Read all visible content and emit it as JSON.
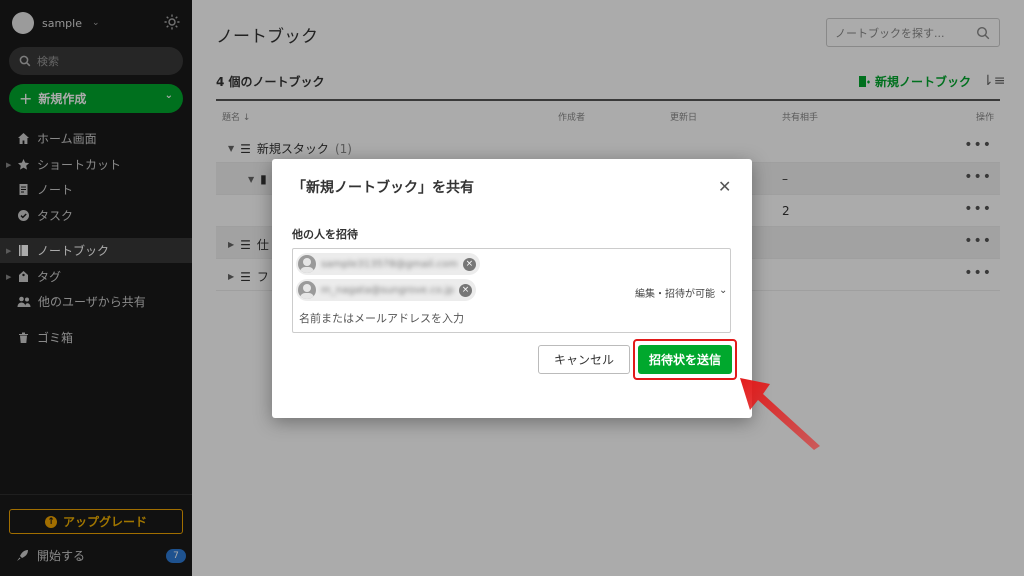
{
  "sidebar": {
    "account_name": "sample",
    "search_placeholder": "検索",
    "new_button": "新規作成",
    "nav": [
      {
        "label": "ホーム画面"
      },
      {
        "label": "ショートカット"
      },
      {
        "label": "ノート"
      },
      {
        "label": "タスク"
      },
      {
        "label": "ノートブック"
      },
      {
        "label": "タグ"
      },
      {
        "label": "他のユーザから共有"
      },
      {
        "label": "ゴミ箱"
      }
    ],
    "upgrade": "アップグレード",
    "get_started": "開始する",
    "get_started_badge": "7"
  },
  "main": {
    "title": "ノートブック",
    "search_placeholder": "ノートブックを探す...",
    "count": "4 個のノートブック",
    "new_notebook": "新規ノートブック",
    "columns": [
      "題名 ↓",
      "作成者",
      "更新日",
      "共有相手",
      "操作"
    ],
    "rows": [
      {
        "title": "新規スタック",
        "count": "(1)",
        "shared": "",
        "actions": "•••"
      },
      {
        "title": "",
        "count": "",
        "shared": "–",
        "actions": "•••"
      },
      {
        "title": "",
        "count": "",
        "shared": "2",
        "actions": "•••"
      },
      {
        "title": "仕",
        "count": "",
        "shared": "",
        "actions": "•••"
      },
      {
        "title": "フ",
        "count": "",
        "shared": "",
        "actions": "•••"
      }
    ]
  },
  "dialog": {
    "title": "「新規ノートブック」を共有",
    "invite_label": "他の人を招待",
    "invitees": [
      {
        "email": "sample313578@gmail.com"
      },
      {
        "email": "m_nagata@sungrove.co.jp"
      }
    ],
    "permission": "編集・招待が可能",
    "input_placeholder": "名前またはメールアドレスを入力",
    "cancel": "キャンセル",
    "send": "招待状を送信"
  },
  "colors": {
    "accent_green": "#00a82d",
    "highlight_red": "#e21a1a",
    "sidebar_bg": "#1a1a1a"
  }
}
